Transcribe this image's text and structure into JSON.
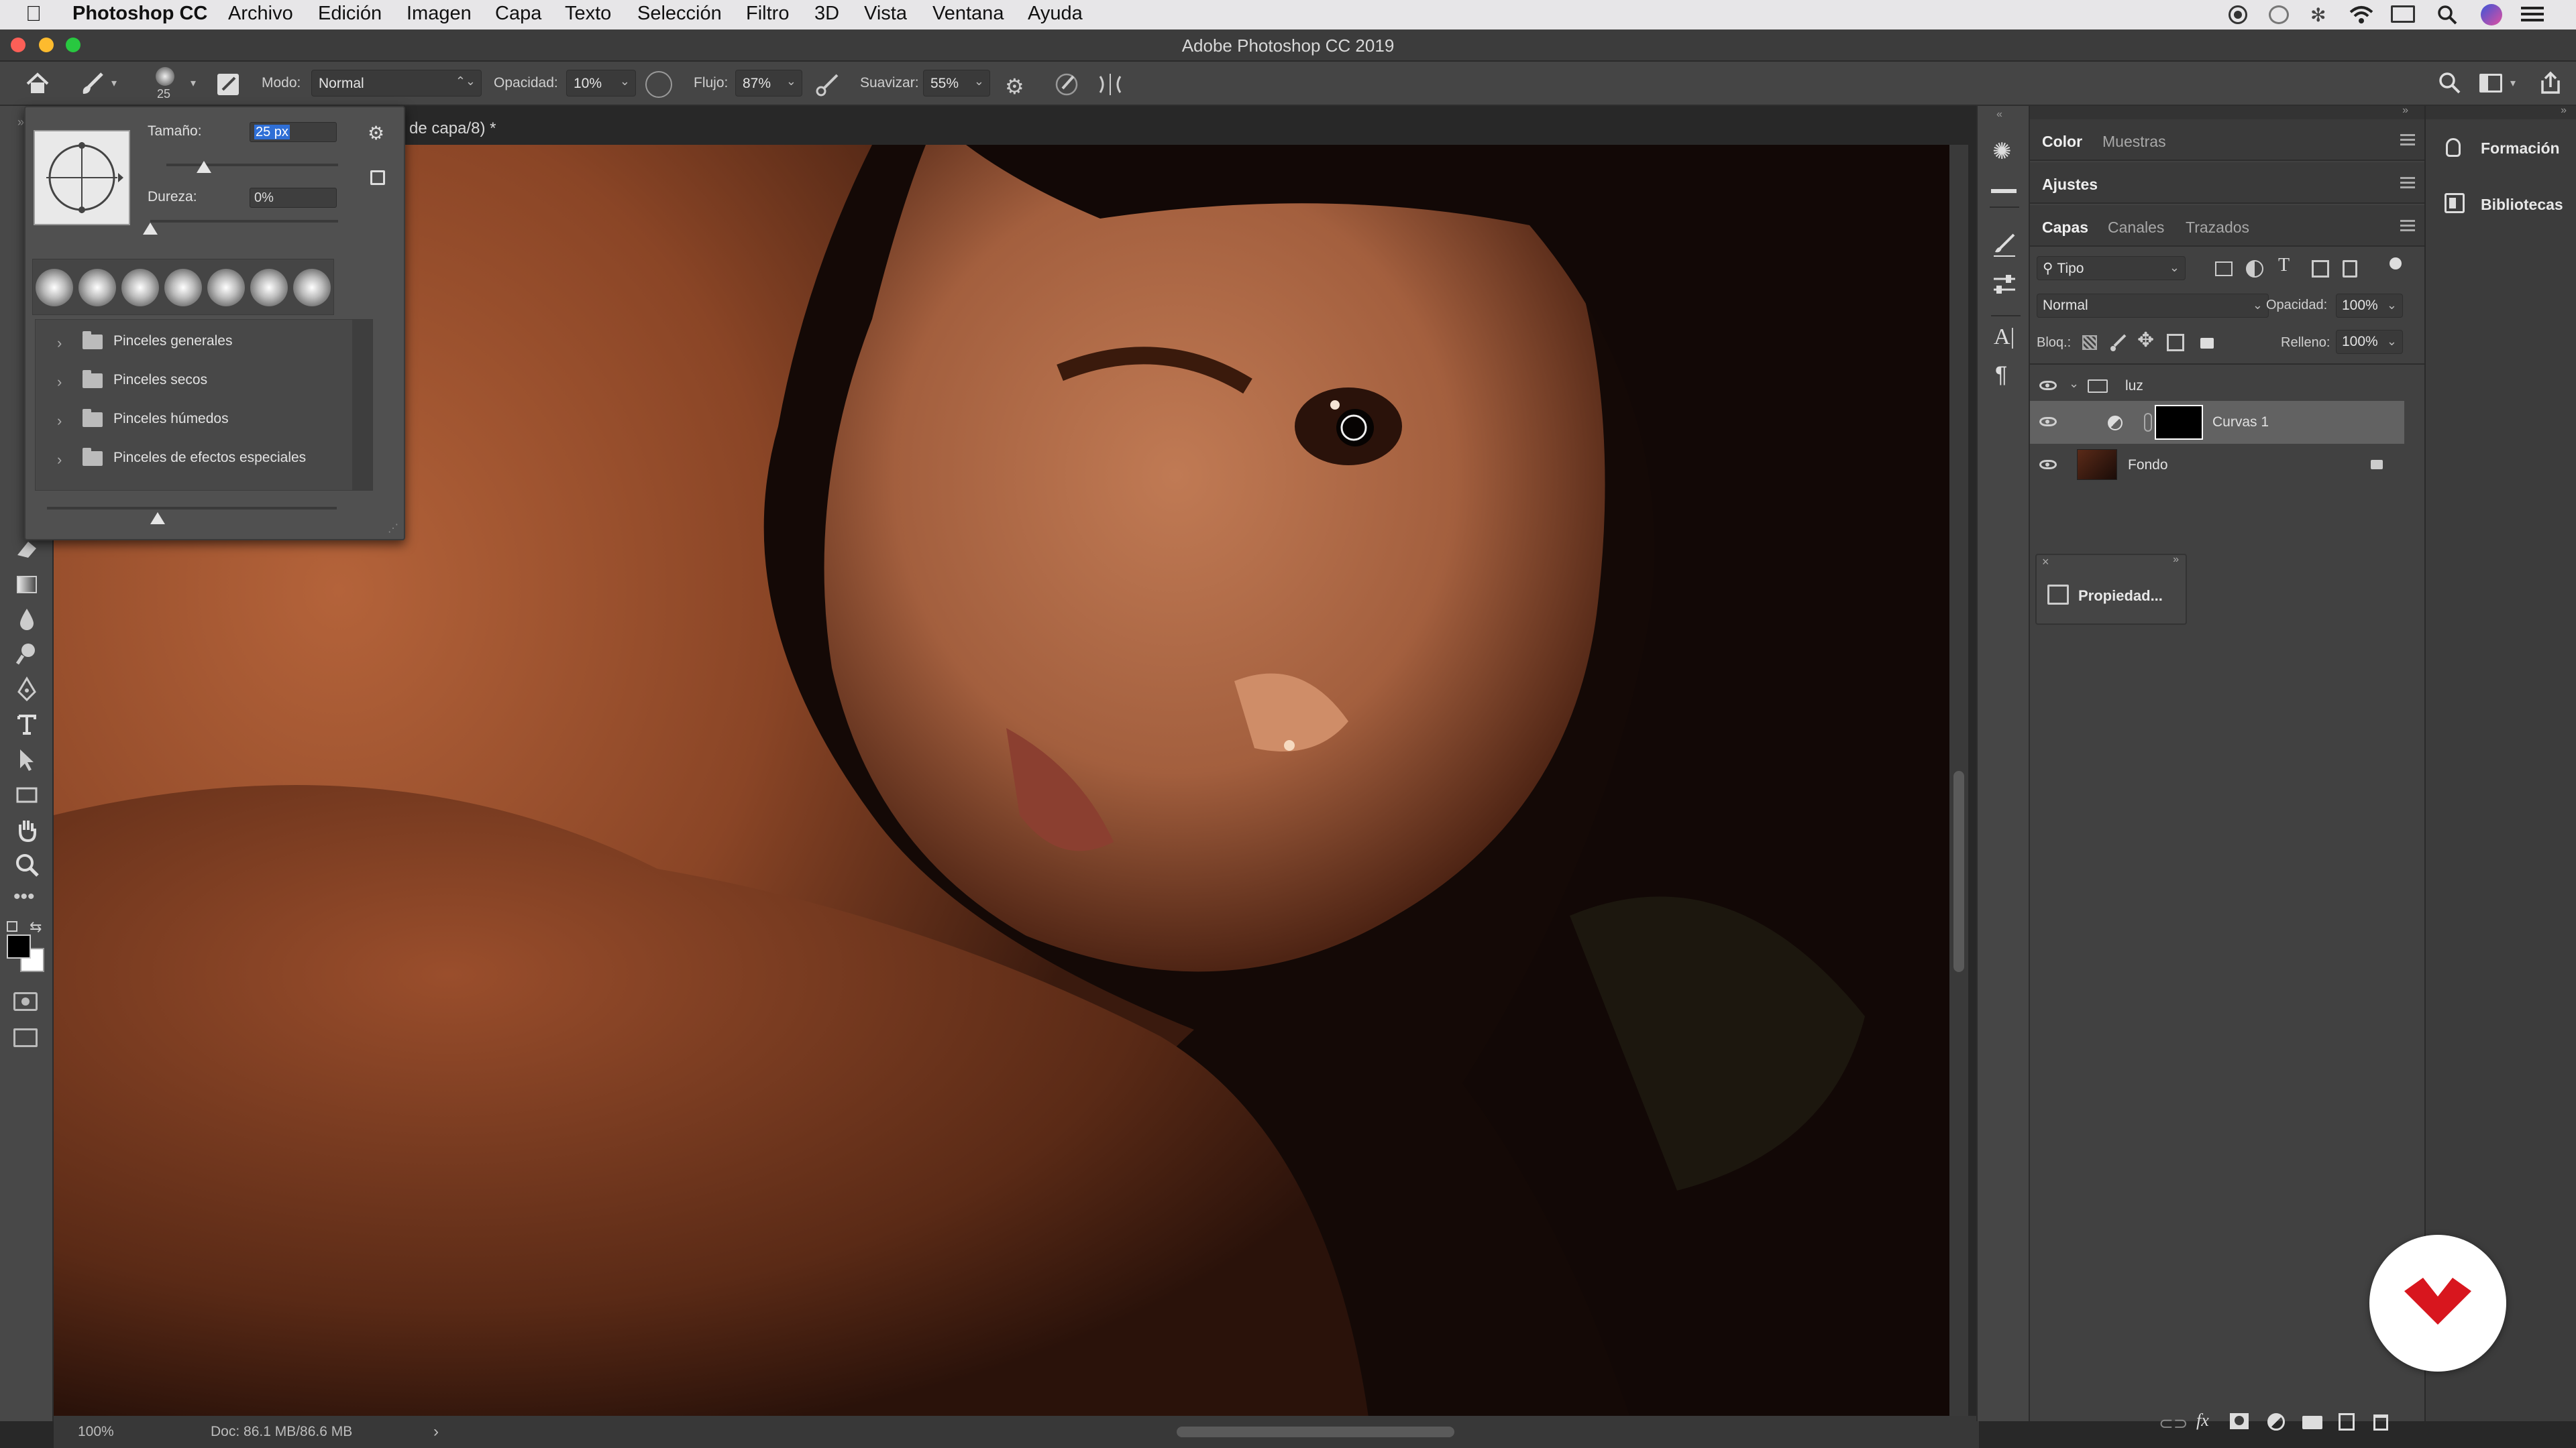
{
  "menubar": {
    "app": "Photoshop CC",
    "items": [
      "Archivo",
      "Edición",
      "Imagen",
      "Capa",
      "Texto",
      "Selección",
      "Filtro",
      "3D",
      "Vista",
      "Ventana",
      "Ayuda"
    ]
  },
  "window": {
    "title": "Adobe Photoshop CC 2019"
  },
  "options_bar": {
    "brush_size": "25",
    "mode_label": "Modo:",
    "mode_value": "Normal",
    "opacity_label": "Opacidad:",
    "opacity_value": "10%",
    "flow_label": "Flujo:",
    "flow_value": "87%",
    "smoothing_label": "Suavizar:",
    "smoothing_value": "55%"
  },
  "brush_popup": {
    "size_label": "Tamaño:",
    "size_value": "25 px",
    "hardness_label": "Dureza:",
    "hardness_value": "0%",
    "size_fraction": 0.22,
    "hardness_fraction": 0.0,
    "folders": [
      "Pinceles generales",
      "Pinceles secos",
      "Pinceles húmedos",
      "Pinceles de efectos especiales"
    ]
  },
  "document": {
    "tab_title": "a de capa/8) *",
    "zoom": "100%",
    "doc_size": "Doc: 86.1 MB/86.6 MB",
    "arrow": "›"
  },
  "panels": {
    "color_tabs": [
      "Color",
      "Muestras"
    ],
    "adjustments_tab": "Ajustes",
    "layers_tabs": [
      "Capas",
      "Canales",
      "Trazados"
    ],
    "filter_kind": "Tipo",
    "blend_mode": "Normal",
    "opacity_label": "Opacidad:",
    "opacity_value": "100%",
    "lock_label": "Bloq.:",
    "fill_label": "Relleno:",
    "fill_value": "100%",
    "layers": [
      {
        "name": "luz",
        "type": "group"
      },
      {
        "name": "Curvas 1",
        "type": "adjustment"
      },
      {
        "name": "Fondo",
        "type": "background"
      }
    ],
    "properties_label": "Propiedad..."
  },
  "right_dock": {
    "items": [
      "Formación",
      "Bibliotecas"
    ]
  },
  "colors": {
    "accent": "#2f6fd6",
    "logo_red": "#d8161e",
    "menubar": "#e7e6e8"
  }
}
